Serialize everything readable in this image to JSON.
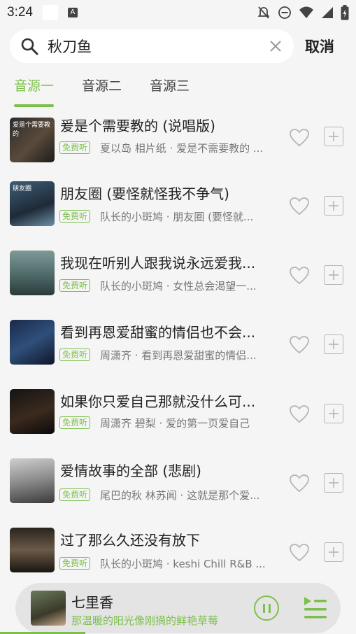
{
  "status": {
    "time": "3:24"
  },
  "search": {
    "query": "秋刀鱼",
    "cancel_label": "取消"
  },
  "tabs": [
    {
      "label": "音源一",
      "active": true
    },
    {
      "label": "音源二",
      "active": false
    },
    {
      "label": "音源三",
      "active": false
    }
  ],
  "free_label": "免费听",
  "songs": [
    {
      "title": "爰是个需要教的 (说唱版)",
      "subtitle": "夏以岛 相片纸 · 爱是不需要教的 ...",
      "cover_caption": "爱是个需要教的"
    },
    {
      "title": "朋友圈 (要怪就怪我不争气)",
      "subtitle": "队长的小斑鸠 · 朋友圈 (要怪就...",
      "cover_caption": "朋友圈"
    },
    {
      "title": "我现在听别人跟我说永远爱我...",
      "subtitle": "队长的小斑鸠 · 女性总会渴望一...",
      "cover_caption": ""
    },
    {
      "title": "看到再恩爱甜蜜的情侣也不会...",
      "subtitle": "周潇齐 · 看到再恩爱甜蜜的情侣...",
      "cover_caption": ""
    },
    {
      "title": "如果你只爱自己那就没什么可...",
      "subtitle": "周潇齐 碧梨 · 爱的第一页爱自己",
      "cover_caption": ""
    },
    {
      "title": "爱情故事的全部 (悲剧)",
      "subtitle": "尾巴的秋 林苏闻 · 这就是那个爱...",
      "cover_caption": ""
    },
    {
      "title": "过了那么久还没有放下",
      "subtitle": "队长的小斑鸠 · keshi Chill R&B ...",
      "cover_caption": ""
    }
  ],
  "player": {
    "title": "七里香",
    "subtitle": "那温暖的阳光像刚摘的鲜艳草莓"
  },
  "colors": {
    "accent": "#7cc04b",
    "background": "#f5f5f5"
  }
}
